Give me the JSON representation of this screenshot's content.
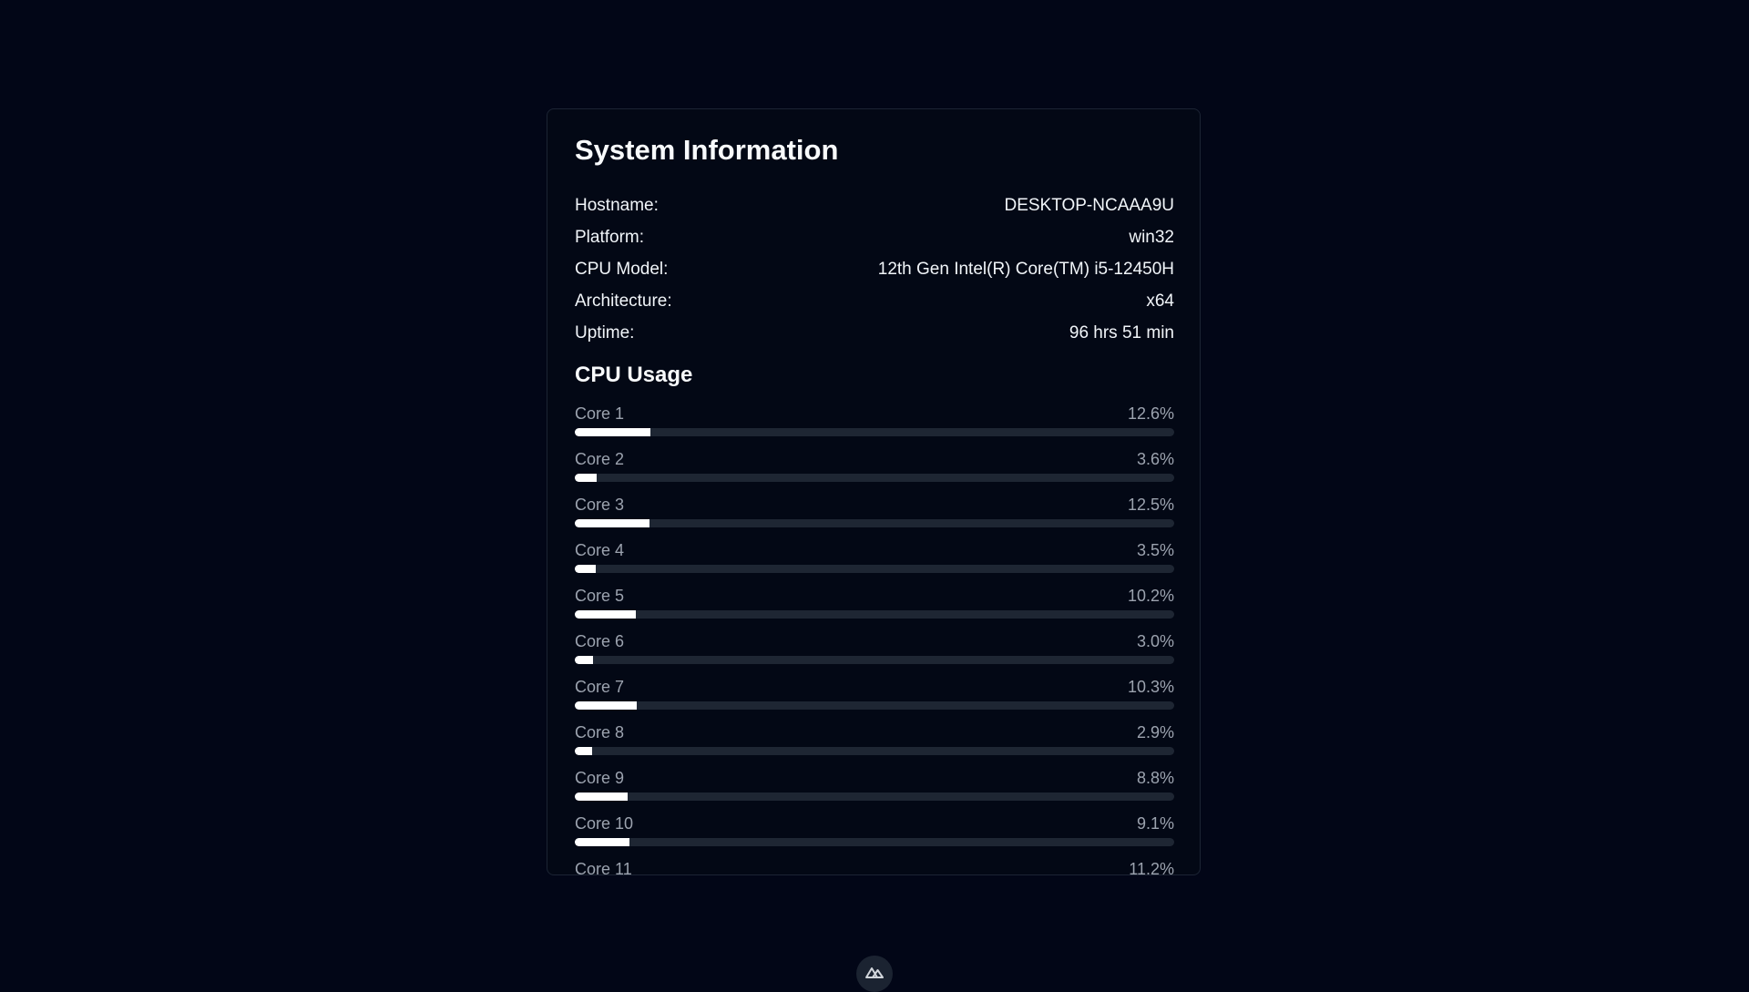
{
  "card": {
    "title": "System Information",
    "info": [
      {
        "label": "Hostname:",
        "value": "DESKTOP-NCAAA9U"
      },
      {
        "label": "Platform:",
        "value": "win32"
      },
      {
        "label": "CPU Model:",
        "value": "12th Gen Intel(R) Core(TM) i5-12450H"
      },
      {
        "label": "Architecture:",
        "value": "x64"
      },
      {
        "label": "Uptime:",
        "value": "96 hrs 51 min"
      }
    ],
    "cpu_title": "CPU Usage",
    "cores": [
      {
        "label": "Core 1",
        "value": "12.6%",
        "percent": 12.6
      },
      {
        "label": "Core 2",
        "value": "3.6%",
        "percent": 3.6
      },
      {
        "label": "Core 3",
        "value": "12.5%",
        "percent": 12.5
      },
      {
        "label": "Core 4",
        "value": "3.5%",
        "percent": 3.5
      },
      {
        "label": "Core 5",
        "value": "10.2%",
        "percent": 10.2
      },
      {
        "label": "Core 6",
        "value": "3.0%",
        "percent": 3.0
      },
      {
        "label": "Core 7",
        "value": "10.3%",
        "percent": 10.3
      },
      {
        "label": "Core 8",
        "value": "2.9%",
        "percent": 2.9
      },
      {
        "label": "Core 9",
        "value": "8.8%",
        "percent": 8.8
      },
      {
        "label": "Core 10",
        "value": "9.1%",
        "percent": 9.1
      },
      {
        "label": "Core 11",
        "value": "11.2%",
        "percent": 11.2
      }
    ]
  },
  "footer": {
    "logo_icon": "nuxt-logo-icon"
  },
  "colors": {
    "background": "#020617",
    "card_border": "#1c2434",
    "bar_track": "#1e2633",
    "bar_fill": "#ffffff",
    "muted_text": "#9ca3af"
  }
}
